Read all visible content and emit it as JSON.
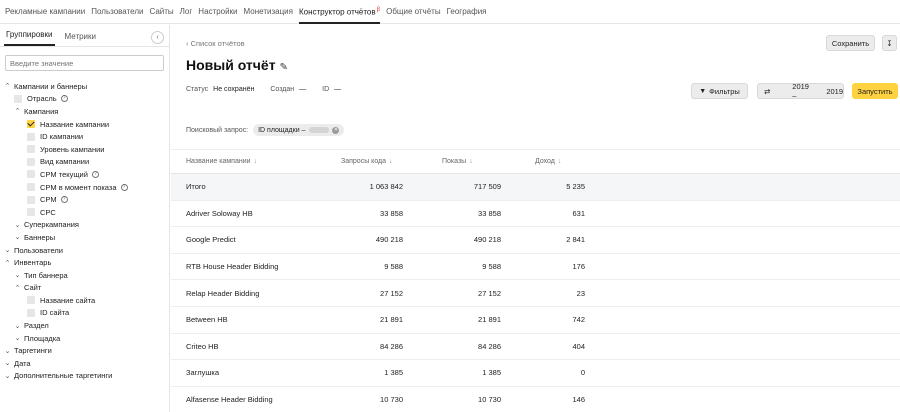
{
  "nav": [
    {
      "label": "Рекламные кампании",
      "active": false
    },
    {
      "label": "Пользователи",
      "active": false
    },
    {
      "label": "Сайты",
      "active": false
    },
    {
      "label": "Лог",
      "active": false
    },
    {
      "label": "Настройки",
      "active": false
    },
    {
      "label": "Монетизация",
      "active": false
    },
    {
      "label": "Конструктор отчётов",
      "active": true,
      "badge": "β"
    },
    {
      "label": "Общие отчёты",
      "active": false
    },
    {
      "label": "География",
      "active": false
    }
  ],
  "left": {
    "tabs": [
      "Группировки",
      "Метрики"
    ],
    "search_placeholder": "Введите значение",
    "tree": [
      {
        "level": 0,
        "chevron": "up",
        "label": "Кампании и баннеры"
      },
      {
        "level": 1,
        "checkbox": false,
        "label": "Отрасль",
        "help": true
      },
      {
        "level": 1,
        "chevron": "up",
        "label": "Кампания"
      },
      {
        "level": 2,
        "checkbox": true,
        "label": "Название кампании"
      },
      {
        "level": 2,
        "checkbox": false,
        "label": "ID кампании"
      },
      {
        "level": 2,
        "checkbox": false,
        "label": "Уровень кампании"
      },
      {
        "level": 2,
        "checkbox": false,
        "label": "Вид кампании"
      },
      {
        "level": 2,
        "checkbox": false,
        "label": "CPM текущий",
        "help": true
      },
      {
        "level": 2,
        "checkbox": false,
        "label": "CPM в момент показа",
        "help": true
      },
      {
        "level": 2,
        "checkbox": false,
        "label": "CPM",
        "help": true
      },
      {
        "level": 2,
        "checkbox": false,
        "label": "CPC"
      },
      {
        "level": 1,
        "chevron": "down",
        "label": "Суперкампания"
      },
      {
        "level": 1,
        "chevron": "down",
        "label": "Баннеры"
      },
      {
        "level": 0,
        "chevron": "down",
        "label": "Пользователи"
      },
      {
        "level": 0,
        "chevron": "up",
        "label": "Инвентарь"
      },
      {
        "level": 1,
        "chevron": "down",
        "label": "Тип баннера"
      },
      {
        "level": 1,
        "chevron": "up",
        "label": "Сайт"
      },
      {
        "level": 2,
        "checkbox": false,
        "label": "Название сайта"
      },
      {
        "level": 2,
        "checkbox": false,
        "label": "ID сайта"
      },
      {
        "level": 1,
        "chevron": "down",
        "label": "Раздел"
      },
      {
        "level": 1,
        "chevron": "down",
        "label": "Площадка"
      },
      {
        "level": 0,
        "chevron": "down",
        "label": "Таргетинги"
      },
      {
        "level": 0,
        "chevron": "down",
        "label": "Дата"
      },
      {
        "level": 0,
        "chevron": "down",
        "label": "Дополнительные таргетинги"
      }
    ]
  },
  "report": {
    "back_label": "‹ Список отчётов",
    "title": "Новый отчёт",
    "save_label": "Сохранить",
    "download_icon": "↧",
    "filters_label": "Фильтры",
    "period_from": "2019 –",
    "period_to": "2019",
    "run_label": "Запустить",
    "status_label": "Статус",
    "status_value": "Не сохранён",
    "created_label": "Создан",
    "created_value": "—",
    "id_label": "ID",
    "id_value": "—",
    "search_query_label": "Поисковый запрос:",
    "chip_label": "ID площадки –"
  },
  "table": {
    "columns": [
      "Название кампании",
      "Запросы кода",
      "Показы",
      "Доход"
    ],
    "sort_icon": "↓",
    "total": {
      "name": "Итого",
      "requests": "1 063 842",
      "shows": "717 509",
      "income": "5 235"
    },
    "rows": [
      {
        "name": "Adriver Soloway HB",
        "requests": "33 858",
        "shows": "33 858",
        "income": "631"
      },
      {
        "name": "Google Predict",
        "requests": "490 218",
        "shows": "490 218",
        "income": "2 841"
      },
      {
        "name": "RTB House Header Bidding",
        "requests": "9 588",
        "shows": "9 588",
        "income": "176"
      },
      {
        "name": "Relap Header Bidding",
        "requests": "27 152",
        "shows": "27 152",
        "income": "23"
      },
      {
        "name": "Between HB",
        "requests": "21 891",
        "shows": "21 891",
        "income": "742"
      },
      {
        "name": "Criteo HB",
        "requests": "84 286",
        "shows": "84 286",
        "income": "404"
      },
      {
        "name": "Заглушка",
        "requests": "1 385",
        "shows": "1 385",
        "income": "0"
      },
      {
        "name": "Alfasense Header Bidding",
        "requests": "10 730",
        "shows": "10 730",
        "income": "146"
      }
    ]
  },
  "colors": {
    "accent": "#ffd23f",
    "beta": "#e53935"
  }
}
